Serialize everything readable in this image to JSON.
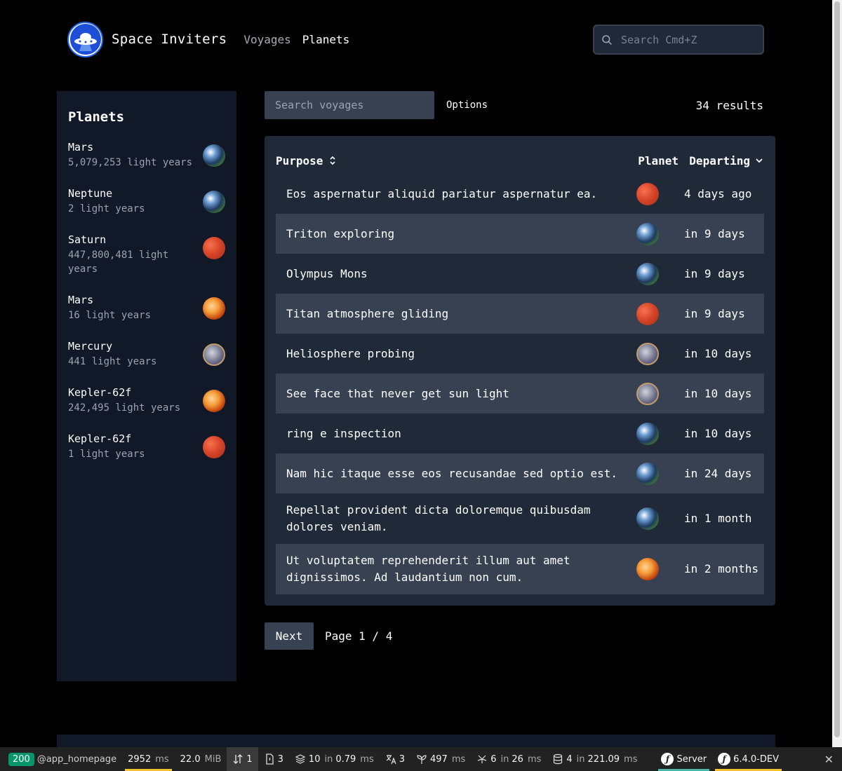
{
  "header": {
    "brand": "Space Inviters",
    "nav": [
      {
        "label": "Voyages",
        "active": false
      },
      {
        "label": "Planets",
        "active": true
      }
    ],
    "search_placeholder": "Search Cmd+Z"
  },
  "sidebar": {
    "title": "Planets",
    "items": [
      {
        "name": "Mars",
        "distance": "5,079,253 light years",
        "icon": "earth-planet-icon"
      },
      {
        "name": "Neptune",
        "distance": "2 light years",
        "icon": "earth-planet-icon"
      },
      {
        "name": "Saturn",
        "distance": "447,800,481 light years",
        "icon": "red-planet-icon"
      },
      {
        "name": "Mars",
        "distance": "16 light years",
        "icon": "orange-planet-icon"
      },
      {
        "name": "Mercury",
        "distance": "441 light years",
        "icon": "grey-planet-icon"
      },
      {
        "name": "Kepler-62f",
        "distance": "242,495 light years",
        "icon": "orange-planet-icon"
      },
      {
        "name": "Kepler-62f",
        "distance": "1 light years",
        "icon": "red-planet-icon"
      }
    ]
  },
  "main": {
    "search_placeholder": "Search voyages",
    "options_label": "Options",
    "results": "34 results",
    "columns": {
      "purpose": "Purpose",
      "planet": "Planet",
      "departing": "Departing"
    },
    "rows": [
      {
        "purpose": "Eos aspernatur aliquid pariatur aspernatur ea.",
        "planet_icon": "red-planet-icon",
        "departing": "4 days ago"
      },
      {
        "purpose": "Triton exploring",
        "planet_icon": "earth-planet-icon",
        "departing": "in 9 days"
      },
      {
        "purpose": "Olympus Mons",
        "planet_icon": "earth-planet-icon",
        "departing": "in 9 days"
      },
      {
        "purpose": "Titan atmosphere gliding",
        "planet_icon": "red-planet-icon",
        "departing": "in 9 days"
      },
      {
        "purpose": "Heliosphere probing",
        "planet_icon": "grey-planet-icon",
        "departing": "in 10 days"
      },
      {
        "purpose": "See face that never get sun light",
        "planet_icon": "grey-planet-icon",
        "departing": "in 10 days"
      },
      {
        "purpose": "ring e inspection",
        "planet_icon": "earth-planet-icon",
        "departing": "in 10 days"
      },
      {
        "purpose": "Nam hic itaque esse eos recusandae sed optio est.",
        "planet_icon": "earth-planet-icon",
        "departing": "in 24 days"
      },
      {
        "purpose": "Repellat provident dicta doloremque quibusdam dolores veniam.",
        "planet_icon": "earth-planet-icon",
        "departing": "in 1 month"
      },
      {
        "purpose": "Ut voluptatem reprehenderit illum aut amet dignissimos. Ad laudantium non cum.",
        "planet_icon": "orange-planet-icon",
        "departing": "in 2 months"
      }
    ],
    "pager": {
      "next_label": "Next",
      "page_info": "Page 1 / 4"
    }
  },
  "devbar": {
    "status": "200",
    "route": "@app_homepage",
    "time": "2952",
    "time_unit": "ms",
    "memory": "22.0",
    "memory_unit": "MiB",
    "requests": "1",
    "logs": "3",
    "cache": "10",
    "cache_in": "in",
    "cache_time": "0.79",
    "cache_unit": "ms",
    "translations": "3",
    "twig": "497",
    "twig_unit": "ms",
    "events": "6",
    "events_in": "in",
    "events_time": "26",
    "events_unit": "ms",
    "db": "4",
    "db_in": "in",
    "db_time": "221.09",
    "db_unit": "ms",
    "server": "Server",
    "version": "6.4.0-DEV"
  },
  "colors": {
    "background": "#000000",
    "panel": "#111827",
    "table": "#1f2937",
    "row_alt": "#374151",
    "accent": "#2563eb",
    "status_ok": "#059669"
  }
}
